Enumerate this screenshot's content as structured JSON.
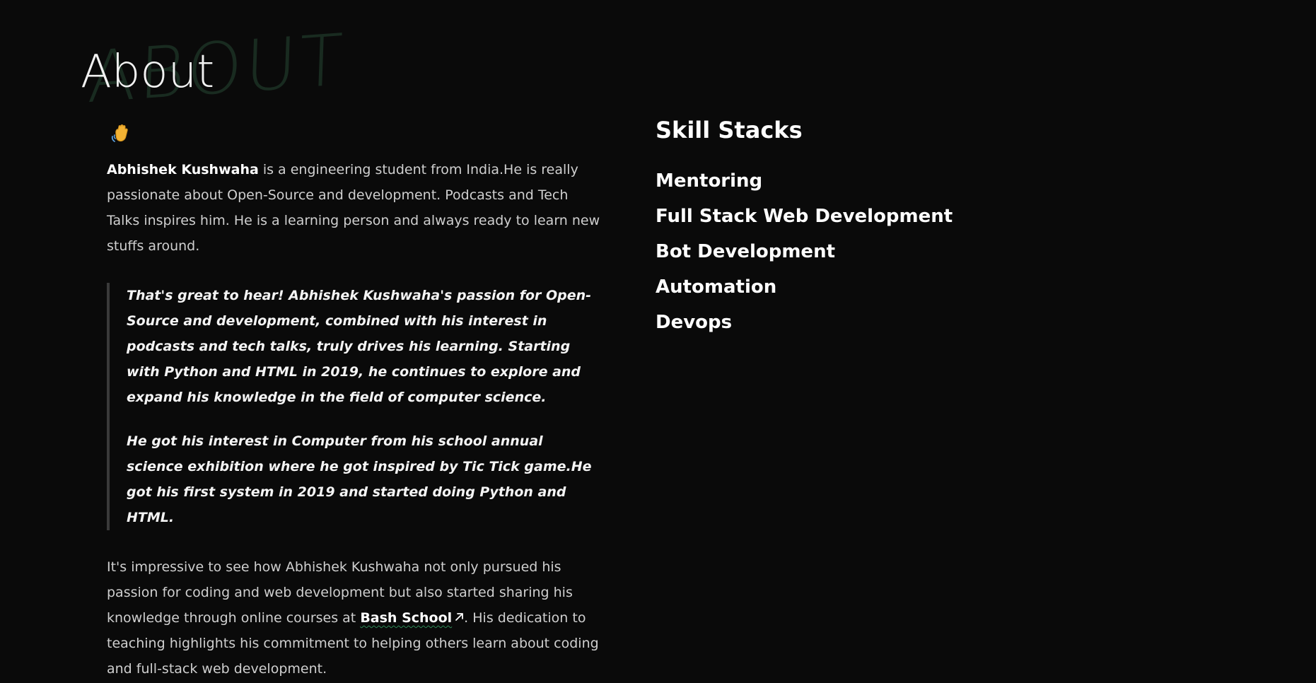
{
  "header": {
    "title": "About",
    "watermark": "ABOUT"
  },
  "intro": {
    "name": "Abhishek Kushwaha",
    "text": " is a engineering student from India.He is really passionate about Open-Source and development. Podcasts and Tech Talks inspires him. He is a learning person and always ready to learn new stuffs around."
  },
  "quote": {
    "paragraph1": "That's great to hear! Abhishek Kushwaha's passion for Open-Source and development, combined with his interest in podcasts and tech talks, truly drives his learning. Starting with Python and HTML in 2019, he continues to explore and expand his knowledge in the field of computer science.",
    "paragraph2": "He got his interest in Computer from his school annual science exhibition where he got inspired by Tic Tick game.He got his first system in 2019 and started doing Python and HTML."
  },
  "outro": {
    "before_link": "It's impressive to see how Abhishek Kushwaha not only pursued his passion for coding and web development but also started sharing his knowledge through online courses at ",
    "link_label": "Bash School",
    "after_link": ". His dedication to teaching highlights his commitment to helping others learn about coding and full-stack web development."
  },
  "skills": {
    "title": "Skill Stacks",
    "items": [
      "Mentoring",
      "Full Stack Web Development",
      "Bot Development",
      "Automation",
      "Devops"
    ]
  },
  "icons": {
    "wave": "waving-hand-icon",
    "external": "external-link-arrow-icon"
  },
  "colors": {
    "background": "#0a0a0a",
    "link_underline": "#2e8b57",
    "watermark": "#1a2d22"
  }
}
